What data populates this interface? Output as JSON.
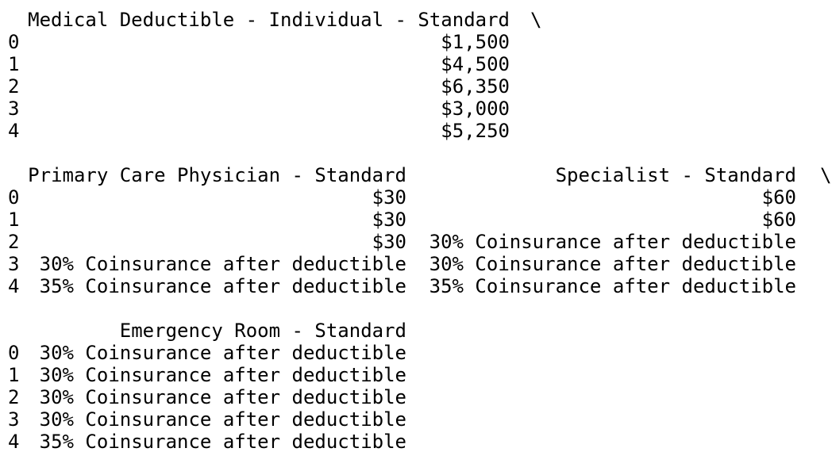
{
  "table1": {
    "header": "Medical Deductible - Individual - Standard",
    "continuation": "\\",
    "rows": [
      {
        "index": "0",
        "value": "$1,500"
      },
      {
        "index": "1",
        "value": "$4,500"
      },
      {
        "index": "2",
        "value": "$6,350"
      },
      {
        "index": "3",
        "value": "$3,000"
      },
      {
        "index": "4",
        "value": "$5,250"
      }
    ]
  },
  "table2": {
    "headers": [
      "Primary Care Physician - Standard",
      "Specialist - Standard"
    ],
    "continuation": "\\",
    "rows": [
      {
        "index": "0",
        "pcp": "$30",
        "specialist": "$60"
      },
      {
        "index": "1",
        "pcp": "$30",
        "specialist": "$60"
      },
      {
        "index": "2",
        "pcp": "$30",
        "specialist": "30% Coinsurance after deductible"
      },
      {
        "index": "3",
        "pcp": "30% Coinsurance after deductible",
        "specialist": "30% Coinsurance after deductible"
      },
      {
        "index": "4",
        "pcp": "35% Coinsurance after deductible",
        "specialist": "35% Coinsurance after deductible"
      }
    ]
  },
  "table3": {
    "header": "Emergency Room - Standard",
    "rows": [
      {
        "index": "0",
        "value": "30% Coinsurance after deductible"
      },
      {
        "index": "1",
        "value": "30% Coinsurance after deductible"
      },
      {
        "index": "2",
        "value": "30% Coinsurance after deductible"
      },
      {
        "index": "3",
        "value": "30% Coinsurance after deductible"
      },
      {
        "index": "4",
        "value": "35% Coinsurance after deductible"
      }
    ]
  }
}
